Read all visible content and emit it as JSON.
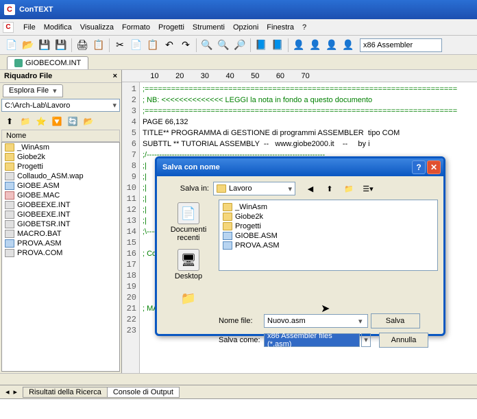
{
  "window": {
    "title": "ConTEXT"
  },
  "menu": [
    "File",
    "Modifica",
    "Visualizza",
    "Formato",
    "Progetti",
    "Strumenti",
    "Opzioni",
    "Finestra",
    "?"
  ],
  "highlighter": "x86 Assembler",
  "open_tab": "GIOBECOM.INT",
  "left_panel": {
    "title": "Riquadro File",
    "tab": "Esplora File",
    "path": "C:\\Arch-Lab\\Lavoro",
    "col": "Nome",
    "items": [
      {
        "n": "_WinAsm",
        "t": "folder"
      },
      {
        "n": "Giobe2k",
        "t": "folder"
      },
      {
        "n": "Progetti",
        "t": "folder"
      },
      {
        "n": "Collaudo_ASM.wap",
        "t": "file-a"
      },
      {
        "n": "GIOBE.ASM",
        "t": "file-b"
      },
      {
        "n": "GIOBE.MAC",
        "t": "file-c"
      },
      {
        "n": "GIOBEEXE.INT",
        "t": "file-a"
      },
      {
        "n": "GIOBEEXE.INT",
        "t": "file-a"
      },
      {
        "n": "GIOBETSR.INT",
        "t": "file-a"
      },
      {
        "n": "MACRO.BAT",
        "t": "file-a"
      },
      {
        "n": "PROVA.ASM",
        "t": "file-b"
      },
      {
        "n": "PROVA.COM",
        "t": "file-a"
      }
    ]
  },
  "ruler": "       10        20        30        40        50        60        70",
  "code": {
    "lines": [
      ";=======================================================================",
      "; NB: <<<<<<<<<<<<<< LEGGI la nota in fondo a questo documento",
      ";=======================================================================",
      "PAGE 66,132",
      "TITLE** PROGRAMMA di GESTIONE di programmi ASSEMBLER  tipo COM",
      "SUBTTL ** TUTORIAL ASSEMBLY  --   www.giobe2000.it    --     by i",
      ";/-----------------------------------------------------------------------",
      ";|",
      ";|",
      ";|",
      ";|                                                           e  di (",
      ";|                                                              .COM (n",
      ";|",
      ";\\-----------------------------------------------------------------------",
      "",
      "; Compilatore                                                    il tasto",
      "",
      "",
      "",
      "",
      "; MA",
      "",
      ""
    ]
  },
  "bottom_tabs": {
    "search": "Risultati della Ricerca",
    "console": "Console di Output"
  },
  "dialog": {
    "title": "Salva con nome",
    "save_in_label": "Salva in:",
    "save_in_value": "Lavoro",
    "sidebar": {
      "recent": "Documenti recenti",
      "desktop": "Desktop"
    },
    "items": [
      {
        "n": "_WinAsm",
        "t": "folder"
      },
      {
        "n": "Giobe2k",
        "t": "folder"
      },
      {
        "n": "Progetti",
        "t": "folder"
      },
      {
        "n": "GIOBE.ASM",
        "t": "file-b"
      },
      {
        "n": "PROVA.ASM",
        "t": "file-b"
      }
    ],
    "filename_label": "Nome file:",
    "filename_value": "Nuovo.asm",
    "saveas_label": "Salva come:",
    "saveas_value": "x86 Assembler files (*.asm)",
    "save_btn": "Salva",
    "cancel_btn": "Annulla"
  }
}
